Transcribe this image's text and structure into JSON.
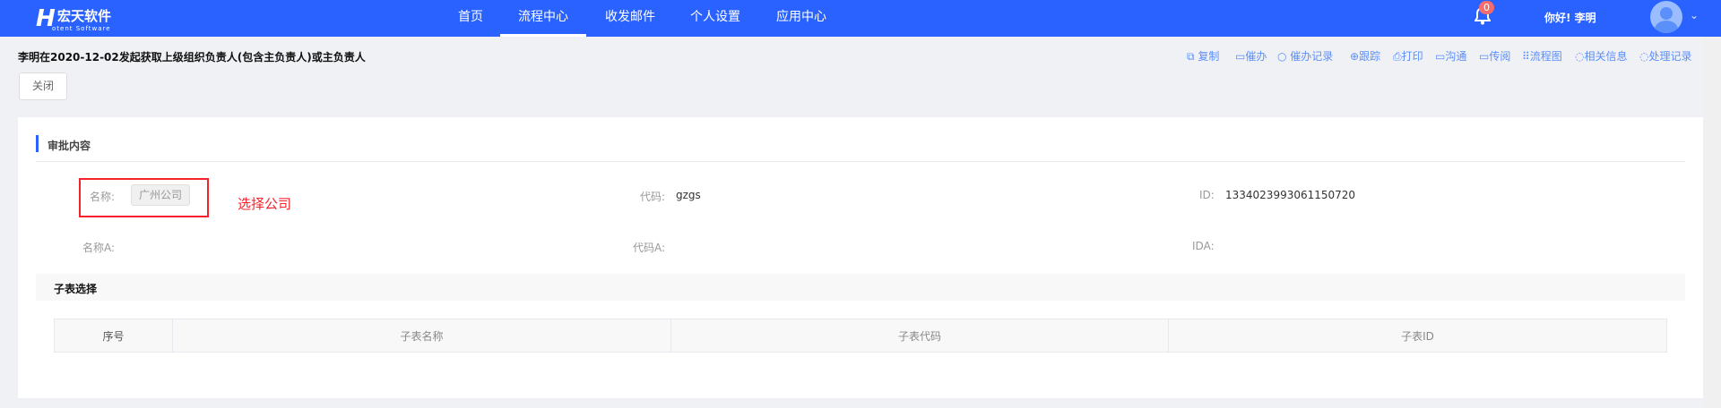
{
  "header": {
    "logo_mark": "H",
    "logo_text": "宏天软件",
    "logo_sub": "otent Software",
    "nav": [
      {
        "label": "首页"
      },
      {
        "label": "流程中心",
        "active": true
      },
      {
        "label": "收发邮件"
      },
      {
        "label": "个人设置"
      },
      {
        "label": "应用中心"
      }
    ],
    "notification_count": "0",
    "greeting": "你好! 李明"
  },
  "page": {
    "title": "李明在2020-12-02发起获取上级组织负责人(包含主负责人)或主负责人",
    "close_label": "关闭",
    "actions": [
      "复制",
      "催办",
      "催办记录",
      "跟踪",
      "打印",
      "沟通",
      "传阅",
      "流程图",
      "相关信息",
      "处理记录"
    ]
  },
  "form": {
    "section_title": "审批内容",
    "name_label": "名称:",
    "name_value": "广州公司",
    "annotation": "选择公司",
    "code_label": "代码:",
    "code_value": "gzgs",
    "id_label": "ID:",
    "id_value": "1334023993061150720",
    "name_a_label": "名称A:",
    "code_a_label": "代码A:",
    "id_a_label": "IDA:"
  },
  "subtable": {
    "title": "子表选择",
    "columns": [
      "序号",
      "子表名称",
      "子表代码",
      "子表ID"
    ]
  },
  "colors": {
    "brand": "#2962ff",
    "annotation": "#f5222d"
  }
}
